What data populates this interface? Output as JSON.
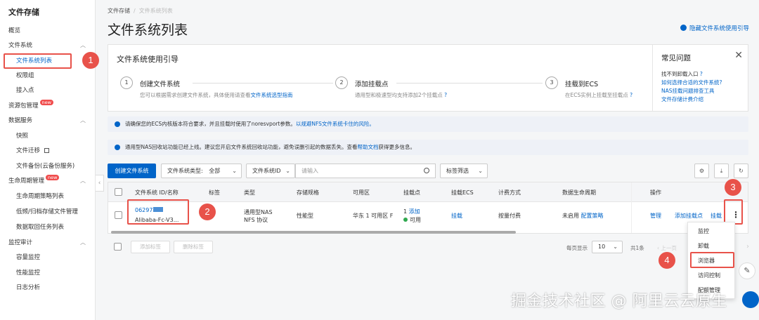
{
  "sidebar": {
    "title": "文件存储",
    "items": [
      {
        "label": "概览"
      },
      {
        "label": "文件系统"
      },
      {
        "label": "文件系统列表"
      },
      {
        "label": "权限组"
      },
      {
        "label": "接入点"
      },
      {
        "label": "资源包管理",
        "badge": "new"
      },
      {
        "label": "数据服务"
      },
      {
        "label": "快照"
      },
      {
        "label": "文件迁移"
      },
      {
        "label": "文件备份(云备份服务)"
      },
      {
        "label": "生命周期管理",
        "badge": "new"
      },
      {
        "label": "生命周期策略列表"
      },
      {
        "label": "低频/归档存储文件管理"
      },
      {
        "label": "数据取回任务列表"
      },
      {
        "label": "监控审计"
      },
      {
        "label": "容量监控"
      },
      {
        "label": "性能监控"
      },
      {
        "label": "日志分析"
      }
    ]
  },
  "annotations": [
    "1",
    "2",
    "3",
    "4"
  ],
  "breadcrumb": {
    "root": "文件存储",
    "sep": "/",
    "current": "文件系统列表"
  },
  "page_title": "文件系统列表",
  "hide_guide": "隐藏文件系统使用引导",
  "guide": {
    "title": "文件系统使用引导",
    "steps": [
      {
        "num": "1",
        "title": "创建文件系统",
        "desc": "您可以根据需求创建文件系统，具体使用请查看",
        "link": "文件系统选型指南"
      },
      {
        "num": "2",
        "title": "添加挂载点",
        "desc": "通用型和极速型均支持添加2个挂载点",
        "link": ""
      },
      {
        "num": "3",
        "title": "挂载到ECS",
        "desc": "在ECS实例上挂载至挂载点",
        "link": ""
      }
    ],
    "faq": {
      "title": "常见问题",
      "items": [
        "找不到卸载入口",
        "如何选择合适的文件系统?",
        "NAS挂载问题排查工具",
        "文件存储计费介绍"
      ]
    }
  },
  "alerts": [
    {
      "text": "请确保您的ECS内核版本符合要求，并且挂载时使用了noresvport参数。",
      "link": "以规避NFS文件系统卡住的风险。",
      "tail": ""
    },
    {
      "text": "通用型NAS回收站功能已经上线。建议您开启文件系统回收站功能，避免误删引起的数据丢失。查看",
      "link": "帮助文档",
      "tail": "获得更多信息。"
    }
  ],
  "toolbar": {
    "create_label": "创建文件系统",
    "type_filter_label": "文件系统类型:",
    "type_filter_value": "全部",
    "id_filter": "文件系统ID",
    "search_placeholder": "请输入",
    "tag_filter": "标签筛选"
  },
  "table": {
    "headers": [
      "文件系统 ID/名称",
      "标签",
      "类型",
      "存储规格",
      "可用区",
      "挂载点",
      "挂载ECS",
      "计费方式",
      "数据生命周期",
      "操作"
    ],
    "row": {
      "id": "06297",
      "name": "Alibaba-Fc-V3...",
      "type_line1": "通用型NAS",
      "type_line2": "NFS 协议",
      "spec": "性能型",
      "zone": "华东 1 可用区 F",
      "mount_count": "1",
      "mount_add": "添加",
      "mount_status": "可用",
      "ecs": "挂载",
      "billing": "按量付费",
      "lifecycle_status": "未启用",
      "lifecycle_config": "配置策略",
      "ops": [
        "管理",
        "添加挂载点",
        "挂载"
      ],
      "more": "⋮"
    }
  },
  "footer": {
    "add_tag": "添加标签",
    "remove_tag": "删除标签",
    "page_size_label": "每页显示",
    "page_size": "10",
    "total": "共1条",
    "prev": "上一页"
  },
  "menu": {
    "items": [
      "监控",
      "卸载",
      "浏览器",
      "访问控制",
      "配额管理"
    ]
  },
  "watermark": "掘金技术社区 @ 阿里云云原生",
  "colors": {
    "primary": "#0064c8",
    "annotation": "#e8524a",
    "badge": "#f04d4d",
    "status_ok": "#2fa84f"
  }
}
